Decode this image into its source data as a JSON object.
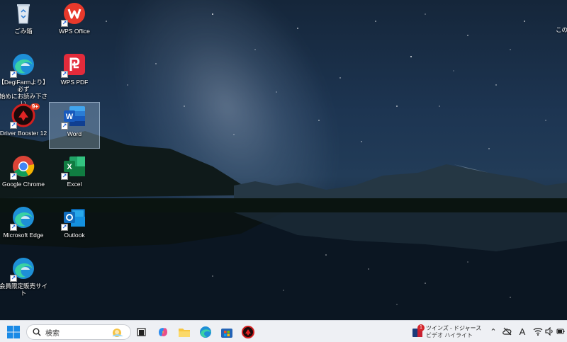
{
  "desktop_icons": [
    {
      "name": "recycle-bin",
      "label": "ごみ箱",
      "shortcut": false
    },
    {
      "name": "wps-office",
      "label": "WPS Office",
      "shortcut": true
    },
    {
      "name": "degifarm-edge",
      "label": "【DegiFarmより】必ず\n始めにお読み下さい",
      "shortcut": true
    },
    {
      "name": "wps-pdf",
      "label": "WPS PDF",
      "shortcut": true
    },
    {
      "name": "driver-booster",
      "label": "Driver Booster 12",
      "shortcut": true,
      "badge": "9+"
    },
    {
      "name": "word",
      "label": "Word",
      "shortcut": true,
      "selected": true
    },
    {
      "name": "google-chrome",
      "label": "Google Chrome",
      "shortcut": true
    },
    {
      "name": "excel",
      "label": "Excel",
      "shortcut": true
    },
    {
      "name": "microsoft-edge",
      "label": "Microsoft Edge",
      "shortcut": true
    },
    {
      "name": "outlook",
      "label": "Outlook",
      "shortcut": true
    },
    {
      "name": "members-shop",
      "label": "会員限定販売サイト",
      "shortcut": true
    },
    {
      "name": "partial-right",
      "label": "この"
    }
  ],
  "taskbar": {
    "search_placeholder": "検索",
    "apps": [
      "start-icon",
      "task-view-icon",
      "copilot-icon",
      "file-explorer-icon",
      "edge-icon",
      "store-icon",
      "driver-booster-icon"
    ]
  },
  "tray": {
    "news_badge": "1",
    "news_title": "ツインズ - ドジャース",
    "news_subtitle": "ビデオ ハイライト",
    "ime_label": "A"
  },
  "colors": {
    "taskbar_bg": "#eef0f4",
    "selection": "#aac8e6"
  }
}
